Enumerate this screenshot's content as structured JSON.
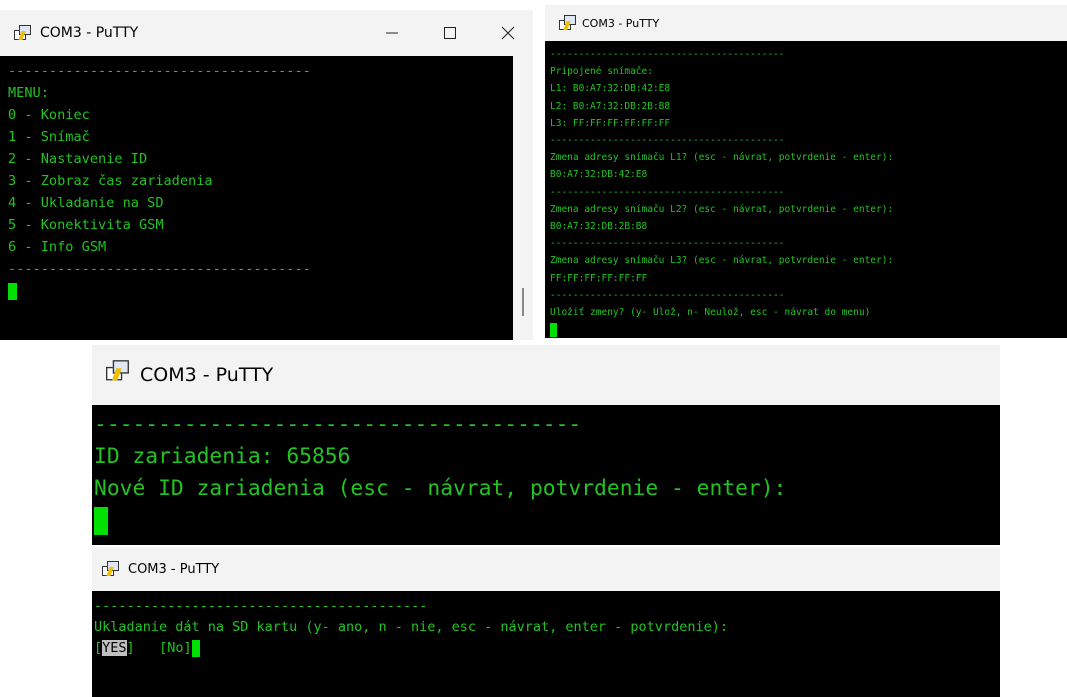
{
  "win1": {
    "title": "COM3 - PuTTY",
    "lines": [
      "-------------------------------------",
      "MENU:",
      "0 - Koniec",
      "1 - Snímač",
      "2 - Nastavenie ID",
      "3 - Zobraz čas zariadenia",
      "4 - Ukladanie na SD",
      "5 - Konektivita GSM",
      "6 - Info GSM",
      "-------------------------------------"
    ],
    "controls": [
      "minimize-icon",
      "maximize-icon",
      "close-icon"
    ]
  },
  "win2": {
    "title": "COM3 - PuTTY",
    "lines": [
      "-----------------------------------------",
      "Pripojené snímače:",
      "L1: B0:A7:32:DB:42:E8",
      "L2: B0:A7:32:DB:2B:B8",
      "L3: FF:FF:FF:FF:FF:FF",
      "-----------------------------------------",
      "Zmena adresy snímaču L1? (esc - návrat, potvrdenie - enter):",
      "B0:A7:32:DB:42:E8",
      "-----------------------------------------",
      "Zmena adresy snímaču L2? (esc - návrat, potvrdenie - enter):",
      "B0:A7:32:DB:2B:B8",
      "-----------------------------------------",
      "Zmena adresy snímaču L3? (esc - návrat, potvrdenie - enter):",
      "FF:FF:FF:FF:FF:FF",
      "-----------------------------------------",
      "Uložiť zmeny? (y- Ulož, n- Neulož, esc - návrat do menu)"
    ]
  },
  "win3": {
    "title": "COM3 - PuTTY",
    "lines": [
      "--------------------------------------",
      "ID zariadenia: 65856",
      "Nové ID zariadenia (esc - návrat, potvrdenie - enter):"
    ]
  },
  "win4": {
    "title": "COM3 - PuTTY",
    "lines": [
      "-----------------------------------------",
      "Ukladanie dát na SD kartu (y- ano, n - nie, esc - návrat, enter - potvrdenie):"
    ],
    "yes_open": "[",
    "yes_label": "YES",
    "yes_close": "]",
    "no_label": "[No]"
  },
  "colors": {
    "terminal_bg": "#000000",
    "terminal_text": "#22c322",
    "cursor": "#00e000",
    "titlebar_bg": "#f3f3f3"
  }
}
